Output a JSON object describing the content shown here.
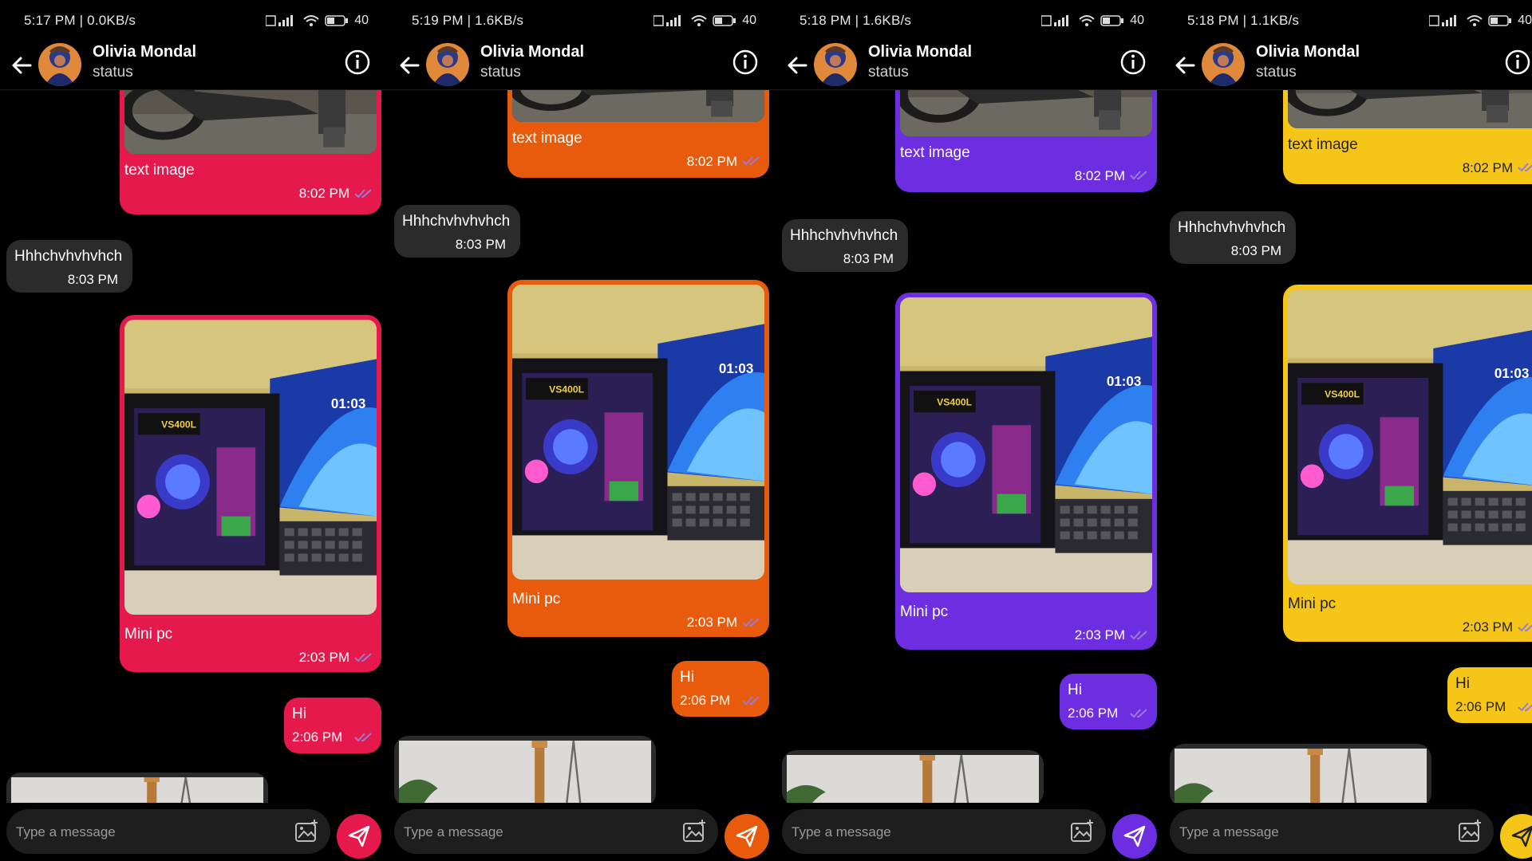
{
  "panels": [
    {
      "status_time": "5:17 PM | 0.0KB/s",
      "battery": "40",
      "accent": "#e5194c"
    },
    {
      "status_time": "5:19 PM | 1.6KB/s",
      "battery": "40",
      "accent": "#e85b0c"
    },
    {
      "status_time": "5:18 PM | 1.6KB/s",
      "battery": "40",
      "accent": "#6c2ee0"
    },
    {
      "status_time": "5:18 PM | 1.1KB/s",
      "battery": "40",
      "accent": "#f5c518"
    }
  ],
  "chat": {
    "contact_name": "Olivia Mondal",
    "contact_status": "status",
    "messages": {
      "text_image": {
        "caption": "text image",
        "time": "8:02 PM"
      },
      "received": {
        "text": "Hhhchvhvhvhch",
        "time": "8:03 PM"
      },
      "mini_pc": {
        "caption": "Mini pc",
        "time": "2:03 PM"
      },
      "hi": {
        "text": "Hi",
        "time": "2:06 PM"
      }
    },
    "pc_screen_clock": "01:03",
    "gpu_label": "VS400L"
  },
  "input": {
    "placeholder": "Type a message"
  },
  "icons": [
    "arrow-left-icon",
    "info-icon",
    "image-attach-icon",
    "send-icon",
    "double-check-icon",
    "signal-icon",
    "wifi-icon",
    "battery-icon"
  ],
  "colors": {
    "received_bubble": "#2b2b2b",
    "input_field": "#1e1e1e",
    "background": "#000000"
  }
}
